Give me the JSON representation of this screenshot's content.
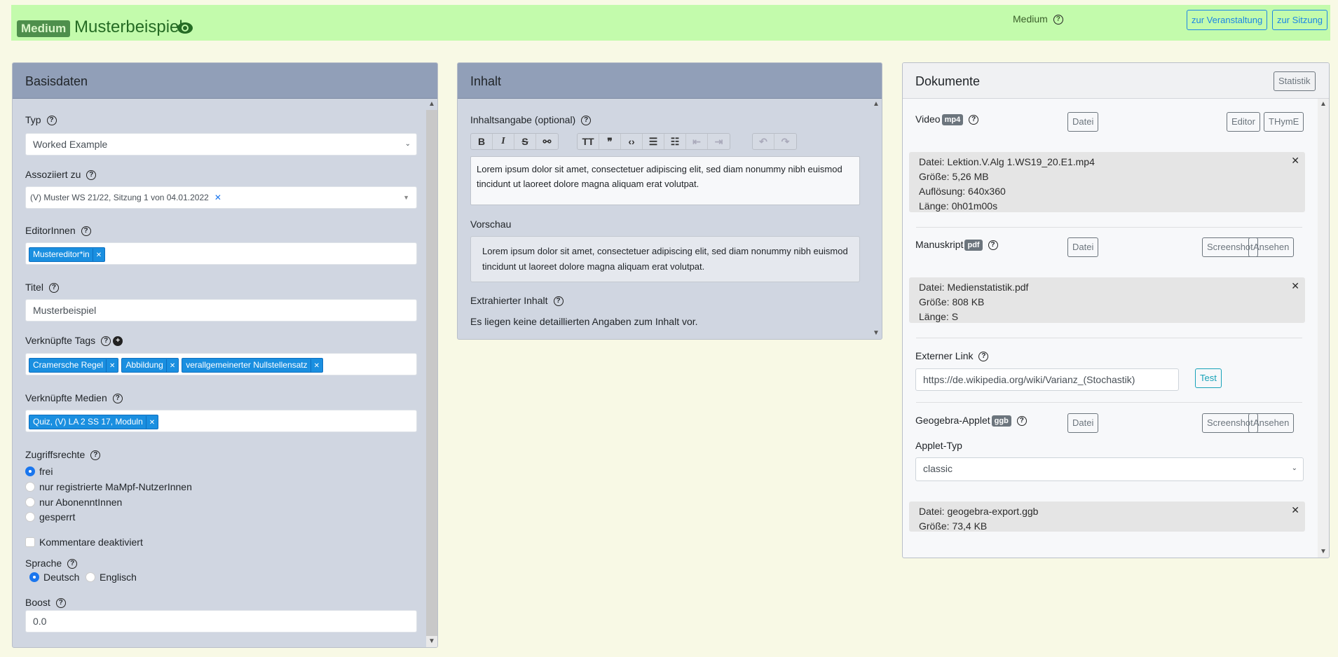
{
  "header": {
    "badge": "Medium",
    "title": "Musterbeispiel",
    "medium_label": "Medium",
    "btn_event": "zur Veranstaltung",
    "btn_session": "zur Sitzung"
  },
  "basis": {
    "title": "Basisdaten",
    "typ_label": "Typ",
    "typ_value": "Worked Example",
    "assoc_label": "Assoziiert zu",
    "assoc_value": "(V) Muster WS 21/22, Sitzung 1 von 04.01.2022",
    "editors_label": "EditorInnen",
    "editors": [
      "Mustereditor*in"
    ],
    "titel_label": "Titel",
    "titel_value": "Musterbeispiel",
    "tags_label": "Verknüpfte Tags",
    "tags": [
      "Cramersche Regel",
      "Abbildung",
      "verallgemeinerter Nullstellensatz"
    ],
    "media_label": "Verknüpfte Medien",
    "media": [
      "Quiz, (V) LA 2 SS 17, Moduln"
    ],
    "access_label": "Zugriffsrechte",
    "access_options": [
      "frei",
      "nur registrierte MaMpf-NutzerInnen",
      "nur AbonenntInnen",
      "gesperrt"
    ],
    "access_selected": "frei",
    "comments_label": "Kommentare deaktiviert",
    "comments_checked": false,
    "lang_label": "Sprache",
    "lang_options": [
      "Deutsch",
      "Englisch"
    ],
    "lang_selected": "Deutsch",
    "boost_label": "Boost",
    "boost_value": "0.0"
  },
  "inhalt": {
    "title": "Inhalt",
    "summary_label": "Inhaltsangabe (optional)",
    "text": "Lorem ipsum dolor sit amet, consectetuer adipiscing elit, sed diam nonummy nibh euismod tincidunt ut laoreet dolore magna aliquam erat volutpat.",
    "preview_label": "Vorschau",
    "extracted_label": "Extrahierter Inhalt",
    "extracted_text": "Es liegen keine detaillierten Angaben zum Inhalt vor."
  },
  "docs": {
    "title": "Dokumente",
    "stat_btn": "Statistik",
    "video": {
      "label": "Video",
      "tag": "mp4",
      "file_btn": "Datei",
      "editor_btn": "Editor",
      "thyme_btn": "THymE",
      "info": [
        "Datei: Lektion.V.Alg 1.WS19_20.E1.mp4",
        "Größe: 5,26 MB",
        "Auflösung: 640x360",
        "Länge: 0h01m00s"
      ]
    },
    "manuscript": {
      "label": "Manuskript",
      "tag": "pdf",
      "file_btn": "Datei",
      "screenshot_btn": "Screenshot",
      "view_btn": "Ansehen",
      "info": [
        "Datei: Medienstatistik.pdf",
        "Größe: 808 KB",
        "Länge: S"
      ]
    },
    "link": {
      "label": "Externer Link",
      "value": "https://de.wikipedia.org/wiki/Varianz_(Stochastik)",
      "test_btn": "Test"
    },
    "geogebra": {
      "label": "Geogebra-Applet",
      "tag": "ggb",
      "file_btn": "Datei",
      "screenshot_btn": "Screenshot",
      "view_btn": "Ansehen",
      "type_label": "Applet-Typ",
      "type_value": "classic",
      "info": [
        "Datei: geogebra-export.ggb",
        "Größe: 73,4 KB"
      ]
    }
  }
}
